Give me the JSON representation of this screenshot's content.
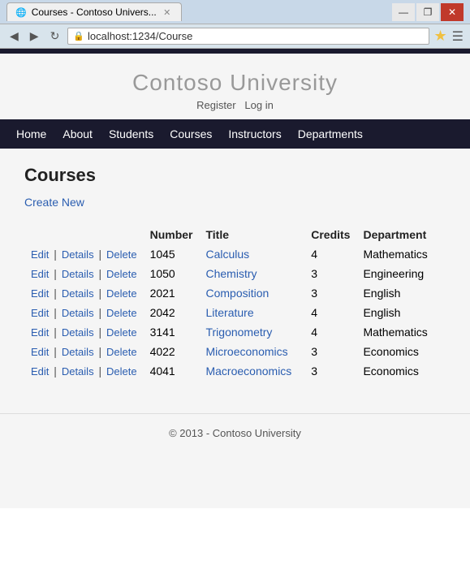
{
  "window": {
    "title": "Courses - Contoso Univers...",
    "url": "localhost:1234/Course"
  },
  "controls": {
    "min": "—",
    "max": "❐",
    "close": "✕"
  },
  "nav_buttons": {
    "back": "◀",
    "forward": "▶",
    "refresh": "↻"
  },
  "site": {
    "title": "Contoso University",
    "auth": {
      "register": "Register",
      "login": "Log in"
    }
  },
  "nav": [
    "Home",
    "About",
    "Students",
    "Courses",
    "Instructors",
    "Departments"
  ],
  "page": {
    "heading": "Courses",
    "create_new": "Create New"
  },
  "table": {
    "headers": [
      "Number",
      "Title",
      "Credits",
      "Department"
    ],
    "rows": [
      {
        "number": "1045",
        "title": "Calculus",
        "credits": "4",
        "department": "Mathematics"
      },
      {
        "number": "1050",
        "title": "Chemistry",
        "credits": "3",
        "department": "Engineering"
      },
      {
        "number": "2021",
        "title": "Composition",
        "credits": "3",
        "department": "English"
      },
      {
        "number": "2042",
        "title": "Literature",
        "credits": "4",
        "department": "English"
      },
      {
        "number": "3141",
        "title": "Trigonometry",
        "credits": "4",
        "department": "Mathematics"
      },
      {
        "number": "4022",
        "title": "Microeconomics",
        "credits": "3",
        "department": "Economics"
      },
      {
        "number": "4041",
        "title": "Macroeconomics",
        "credits": "3",
        "department": "Economics"
      }
    ],
    "actions": {
      "edit": "Edit",
      "details": "Details",
      "delete": "Delete"
    }
  },
  "footer": {
    "text": "© 2013 - Contoso University"
  }
}
